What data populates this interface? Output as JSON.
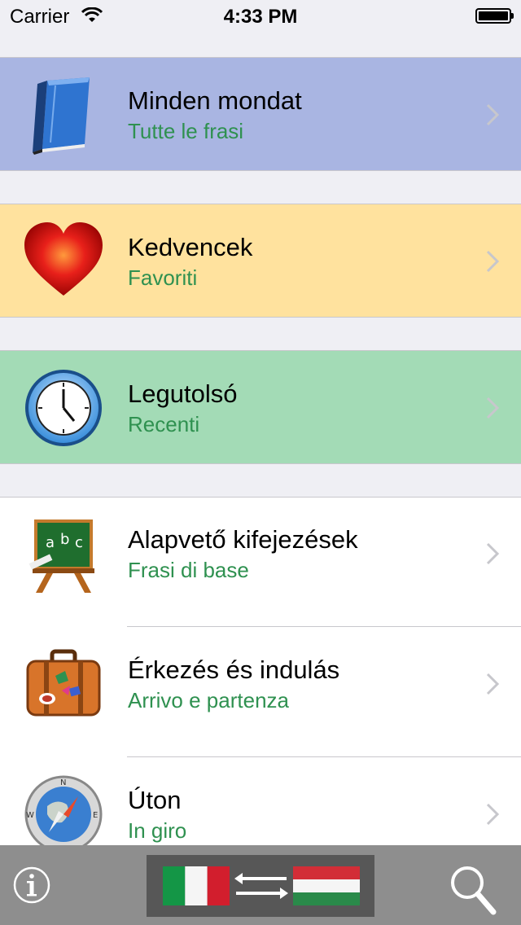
{
  "status_bar": {
    "carrier": "Carrier",
    "time": "4:33 PM"
  },
  "colors": {
    "blue_row": "#a9b5e2",
    "yellow_row": "#ffe29e",
    "green_row": "#a3dbb6",
    "subtitle_green": "#2f9150",
    "toolbar": "#8e8e8e"
  },
  "rows": [
    {
      "title": "Minden mondat",
      "subtitle": "Tutte le frasi",
      "icon": "book-icon"
    },
    {
      "title": "Kedvencek",
      "subtitle": "Favoriti",
      "icon": "heart-icon"
    },
    {
      "title": "Legutolsó",
      "subtitle": "Recenti",
      "icon": "clock-icon"
    },
    {
      "title": "Alapvető kifejezések",
      "subtitle": "Frasi di base",
      "icon": "chalkboard-icon"
    },
    {
      "title": "Érkezés és indulás",
      "subtitle": "Arrivo e partenza",
      "icon": "suitcase-icon"
    },
    {
      "title": "Úton",
      "subtitle": "In giro",
      "icon": "compass-icon"
    }
  ],
  "toolbar": {
    "info_icon": "info-icon",
    "language_switch": {
      "from_flag": "italy-flag-icon",
      "to_flag": "hungary-flag-icon",
      "arrows": "swap-arrows-icon"
    },
    "search_icon": "search-icon"
  }
}
